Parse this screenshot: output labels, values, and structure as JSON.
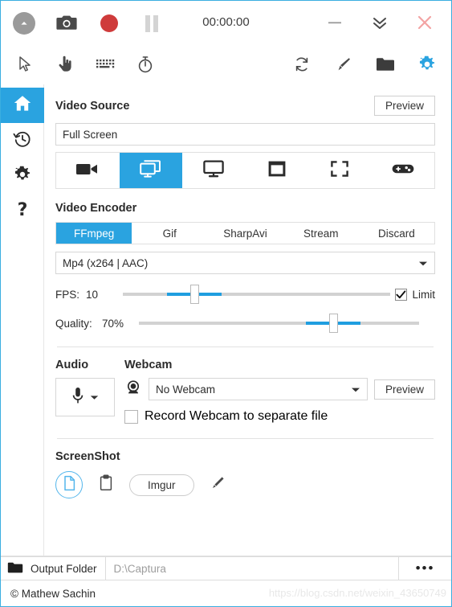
{
  "window": {
    "timer": "00:00:00",
    "accent": "#2aa3e0",
    "record_color": "#cf3b3b",
    "close_color": "#f3a3a3",
    "controls": {
      "collapse_label": "collapse-toggle",
      "screenshot_label": "screenshot",
      "record_label": "record",
      "pause_label": "pause",
      "minimize_label": "minimize",
      "shrink_label": "shrink",
      "close_label": "close"
    }
  },
  "toolbar": {
    "left": [
      {
        "name": "cursor-icon",
        "label": "Include Cursor"
      },
      {
        "name": "hand-click-icon",
        "label": "Include Clicks"
      },
      {
        "name": "keyboard-icon",
        "label": "Include Keystrokes"
      },
      {
        "name": "timer-icon",
        "label": "Timer"
      }
    ],
    "right": [
      {
        "name": "refresh-icon",
        "label": "Refresh"
      },
      {
        "name": "brush-icon",
        "label": "Theme"
      },
      {
        "name": "folder-icon",
        "label": "Open Folder"
      },
      {
        "name": "gear-icon",
        "label": "Settings"
      }
    ]
  },
  "sidebar": {
    "items": [
      {
        "name": "sidebar-item-home",
        "label": "Home",
        "active": true
      },
      {
        "name": "sidebar-item-recent",
        "label": "Recent",
        "active": false
      },
      {
        "name": "sidebar-item-configure",
        "label": "Configure",
        "active": false
      },
      {
        "name": "sidebar-item-about",
        "label": "About",
        "active": false
      }
    ]
  },
  "video_source": {
    "title": "Video Source",
    "preview_label": "Preview",
    "value": "Full Screen",
    "modes": [
      {
        "name": "source-video-device",
        "label": "Video Device",
        "active": false
      },
      {
        "name": "source-screen",
        "label": "Screen",
        "active": true
      },
      {
        "name": "source-desktop",
        "label": "Desktop",
        "active": false
      },
      {
        "name": "source-window",
        "label": "Window",
        "active": false
      },
      {
        "name": "source-region",
        "label": "Region",
        "active": false
      },
      {
        "name": "source-game",
        "label": "Game",
        "active": false
      }
    ]
  },
  "video_encoder": {
    "title": "Video Encoder",
    "tabs": [
      {
        "label": "FFmpeg",
        "active": true
      },
      {
        "label": "Gif",
        "active": false
      },
      {
        "label": "SharpAvi",
        "active": false
      },
      {
        "label": "Stream",
        "active": false
      },
      {
        "label": "Discard",
        "active": false
      }
    ],
    "codec": "Mp4 (x264 | AAC)",
    "fps": {
      "label": "FPS:",
      "value": "10",
      "percent": 26,
      "limit_label": "Limit",
      "limit_checked": true
    },
    "quality": {
      "label": "Quality:",
      "value": "70%",
      "percent": 70
    }
  },
  "audio": {
    "title": "Audio",
    "device_icon": "microphone-icon"
  },
  "webcam": {
    "title": "Webcam",
    "value": "No Webcam",
    "preview_label": "Preview",
    "separate_file_label": "Record Webcam to separate file",
    "separate_file_checked": false
  },
  "screenshot": {
    "title": "ScreenShot",
    "save_to_disk_label": "Save to Disk",
    "copy_to_clipboard_label": "Copy to Clipboard",
    "imgur_label": "Imgur",
    "edit_label": "Edit"
  },
  "output": {
    "folder_label": "Output Folder",
    "path": "D:\\Captura",
    "more_label": "•••"
  },
  "status": {
    "text": "© Mathew Sachin",
    "watermark": "https://blog.csdn.net/weixin_43650749"
  }
}
